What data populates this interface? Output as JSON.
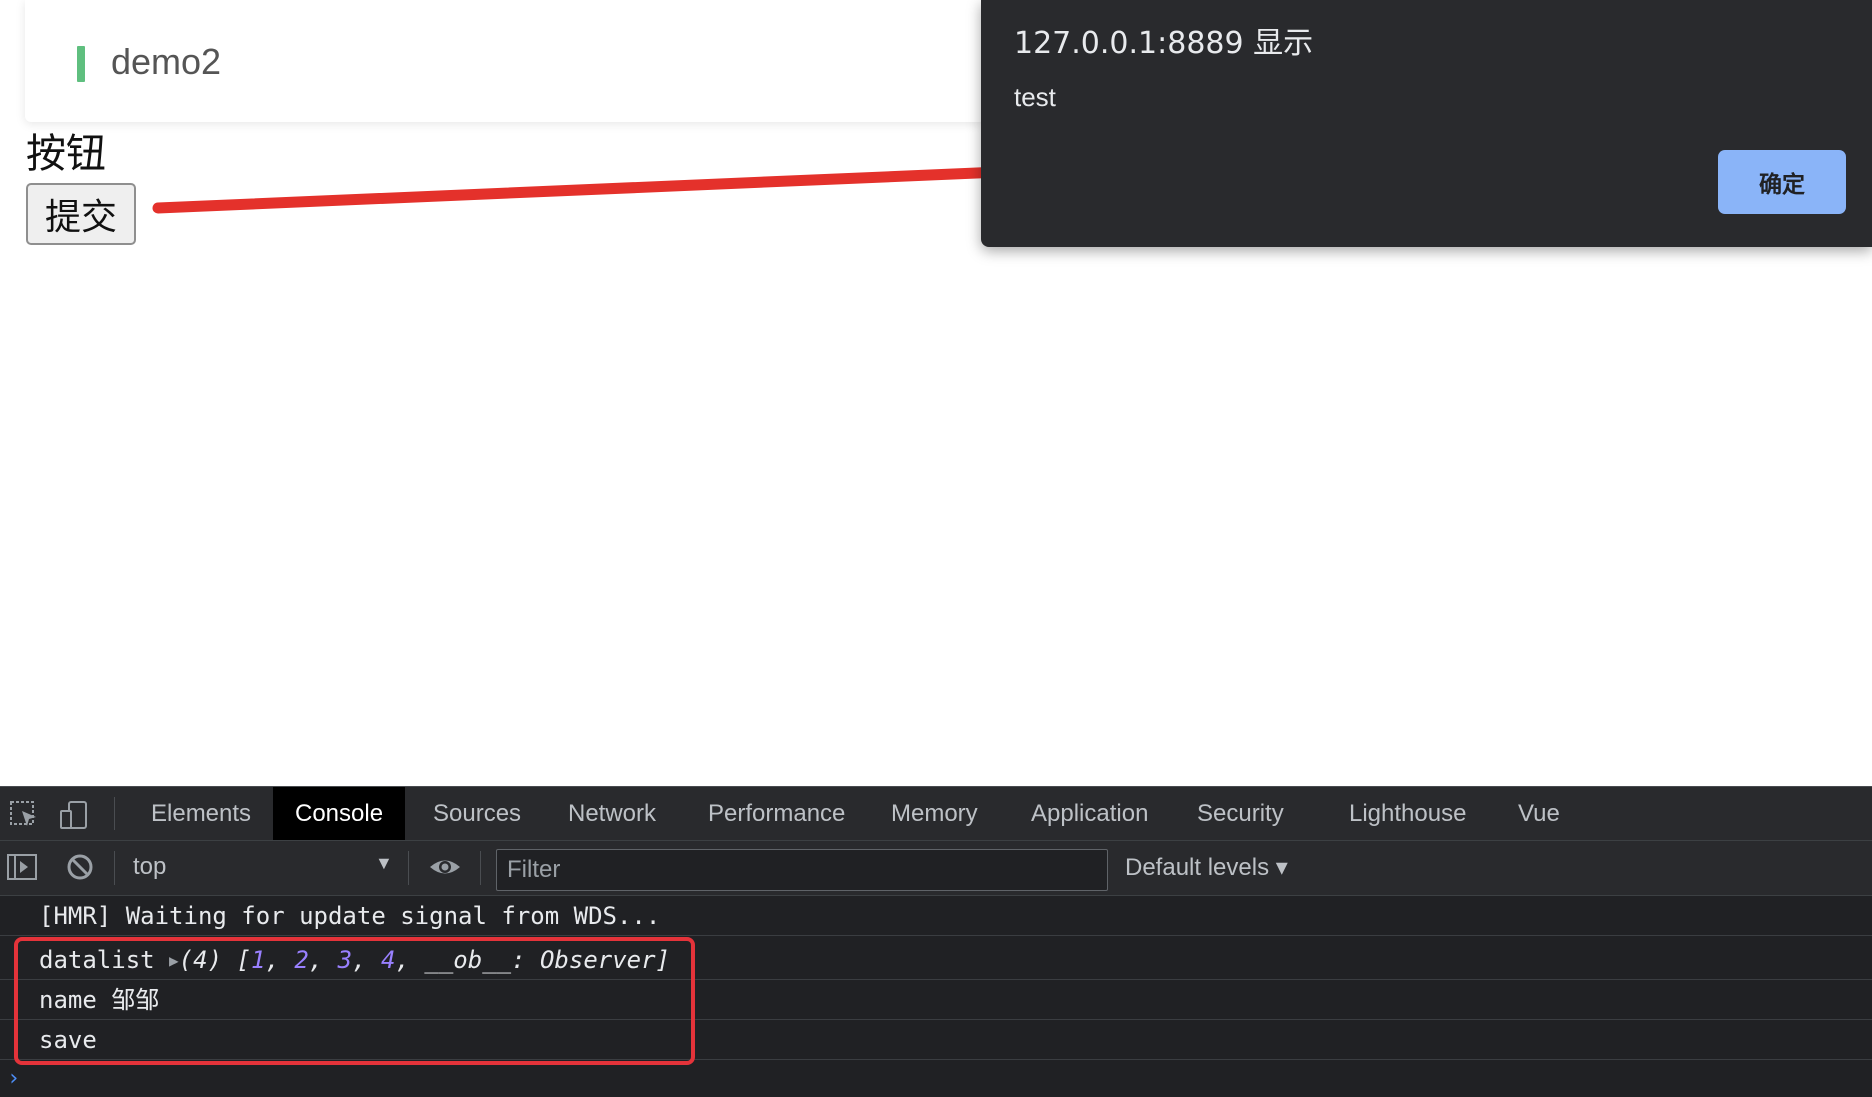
{
  "page": {
    "card_title": "demo2",
    "section_label": "按钮",
    "submit_button": "提交"
  },
  "alert": {
    "title": "127.0.0.1:8889 显示",
    "message": "test",
    "ok_label": "确定"
  },
  "devtools": {
    "tabs": [
      {
        "label": "Elements"
      },
      {
        "label": "Console",
        "active": true
      },
      {
        "label": "Sources"
      },
      {
        "label": "Network"
      },
      {
        "label": "Performance"
      },
      {
        "label": "Memory"
      },
      {
        "label": "Application"
      },
      {
        "label": "Security"
      },
      {
        "label": "Lighthouse"
      },
      {
        "label": "Vue"
      }
    ],
    "toolbar": {
      "context": "top",
      "filter_placeholder": "Filter",
      "levels": "Default levels ▾"
    },
    "console": {
      "lines": [
        {
          "text": "[HMR] Waiting for update signal from WDS..."
        },
        {
          "label": "datalist",
          "count": "(4)",
          "values": [
            "1",
            "2",
            "3",
            "4"
          ],
          "observer": "__ob__: Observer"
        },
        {
          "text": "name 邹邹"
        },
        {
          "text": "save"
        }
      ],
      "prompt": "›"
    }
  },
  "colors": {
    "annotation_arrow": "#e4312b",
    "card_accent": "#5fbf7f",
    "alert_button": "#8ab4f8"
  }
}
